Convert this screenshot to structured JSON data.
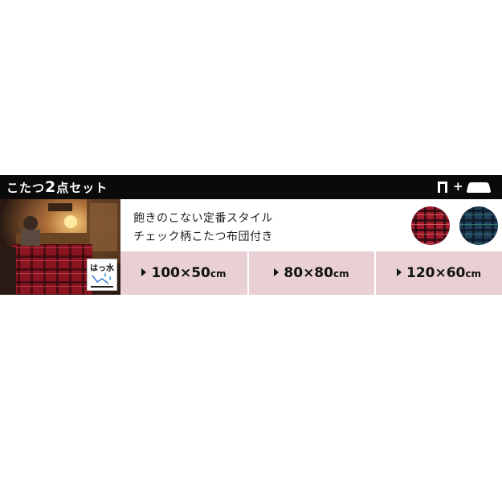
{
  "header": {
    "title_prefix": "こたつ",
    "title_number": "2",
    "title_suffix": "点セット",
    "set_icons": [
      "kotatsu-table-icon",
      "plus-icon",
      "futon-icon"
    ],
    "plus_symbol": "+"
  },
  "badge": {
    "label": "はっ水",
    "icon": "water-repellent-icon"
  },
  "description": {
    "line1": "飽きのこない定番スタイル",
    "line2": "チェック柄こたつ布団付き"
  },
  "swatches": [
    {
      "name": "red-check",
      "color": "#a11a2a"
    },
    {
      "name": "blue-check",
      "color": "#1f3f5a"
    }
  ],
  "sizes": [
    {
      "value": "100×50",
      "unit": "cm"
    },
    {
      "value": "80×80",
      "unit": "cm"
    },
    {
      "value": "120×60",
      "unit": "cm"
    }
  ],
  "colors": {
    "header_bg": "#0a0a0a",
    "size_bar_bg": "#e9d0d4",
    "text": "#222222"
  }
}
